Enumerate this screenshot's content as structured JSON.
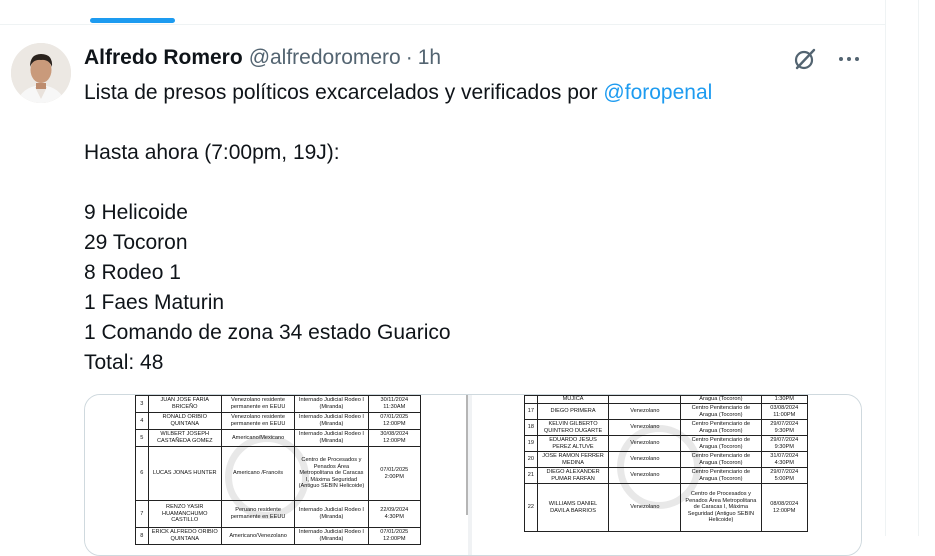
{
  "tweet": {
    "author": "Alfredo Romero",
    "handle": "@alfredoromero",
    "separator": "·",
    "time": "1h",
    "lines": [
      {
        "text": "Lista de presos políticos excarcelados y verificados por ",
        "mention": "@foropenal"
      },
      {
        "text": ""
      },
      {
        "text": "Hasta ahora (7:00pm, 19J):"
      },
      {
        "text": ""
      },
      {
        "text": "9 Helicoide"
      },
      {
        "text": "29 Tocoron"
      },
      {
        "text": "8 Rodeo 1"
      },
      {
        "text": "1 Faes Maturin"
      },
      {
        "text": "1 Comando de zona 34 estado Guarico"
      },
      {
        "text": "Total: 48"
      }
    ],
    "icons": {
      "grok": "grok-icon",
      "more": "more-icon"
    }
  },
  "media": {
    "left_rows": [
      {
        "n": "3",
        "name": "JUAN JOSE FARIA BRICEÑO",
        "nat": "Venezolano residente permanente en EEUU",
        "place": "Internado Judicial Rodeo I (Miranda)",
        "date": "30/11/2024 11:30AM"
      },
      {
        "n": "4",
        "name": "RONALD ORIBIO QUINTANA",
        "nat": "Venezolano residente permanente en EEUU",
        "place": "Internado Judicial Rodeo I (Miranda)",
        "date": "07/01/2025 12:00PM"
      },
      {
        "n": "5",
        "name": "WILBERT JOSEPH CASTAÑEDA GOMEZ",
        "nat": "Americano/Mexicano",
        "place": "Internado Judicial Rodeo I (Miranda)",
        "date": "30/08/2024 12:00PM"
      },
      {
        "n": "6",
        "name": "LUCAS JONAS HUNTER",
        "nat": "Americano /Francés",
        "place": "Centro de Procesados y Penados Área Metropolitana de Caracas I, Máxima Seguridad (Antiguo SEBIN Helicoide)",
        "date": "07/01/2025 2:00PM"
      },
      {
        "n": "7",
        "name": "RENZO YASIR HUAMANCHUMO CASTILLO",
        "nat": "Peruano residente permanente en EEUU",
        "place": "Internado Judicial Rodeo I (Miranda)",
        "date": "22/09/2024 4:30PM"
      },
      {
        "n": "8",
        "name": "ERICK ALFREDO ORIBIO QUINTANA",
        "nat": "Americano/Venezolano",
        "place": "Internado Judicial Rodeo I (Miranda)",
        "date": "07/01/2025 12:00PM"
      }
    ],
    "right_rows": [
      {
        "n": "",
        "name": "MUJICA",
        "nat": "",
        "place": "Aragua (Tocoron)",
        "date": "1:30PM"
      },
      {
        "n": "17",
        "name": "DIEGO PRIMERA",
        "nat": "Venezolano",
        "place": "Centro Penitenciario de Aragua (Tocoron)",
        "date": "03/08/2024 11:00PM"
      },
      {
        "n": "18",
        "name": "KELVIN GILBERTO QUINTERO DUGARTE",
        "nat": "Venezolano",
        "place": "Centro Penitenciario de Aragua (Tocoron)",
        "date": "29/07/2024 9:30PM"
      },
      {
        "n": "19",
        "name": "EDUARDO JESUS PEREZ ALTUVE",
        "nat": "Venezolano",
        "place": "Centro Penitenciario de Aragua (Tocoron)",
        "date": "29/07/2024 9:30PM"
      },
      {
        "n": "20",
        "name": "JOSE RAMON FERRER MEDINA",
        "nat": "Venezolano",
        "place": "Centro Penitenciario de Aragua (Tocoron)",
        "date": "31/07/2024 4:30PM"
      },
      {
        "n": "21",
        "name": "DIEGO ALEXANDER PUMAR FARFAN",
        "nat": "Venezolano",
        "place": "Centro Penitenciario de Aragua (Tocoron)",
        "date": "29/07/2024 5:00PM"
      },
      {
        "n": "22",
        "name": "WILLIAMS DANIEL DAVILA BARRIOS",
        "nat": "Venezolano",
        "place": "Centro de Procesados y Penados Área Metropolitana de Caracas I, Máxima Seguridad (Antiguo SEBIN Helicoide)",
        "date": "08/08/2024 12:00PM"
      }
    ]
  },
  "colors": {
    "accent": "#1d9bf0",
    "text": "#0f1419",
    "secondary": "#536471",
    "border": "#eff3f4"
  }
}
